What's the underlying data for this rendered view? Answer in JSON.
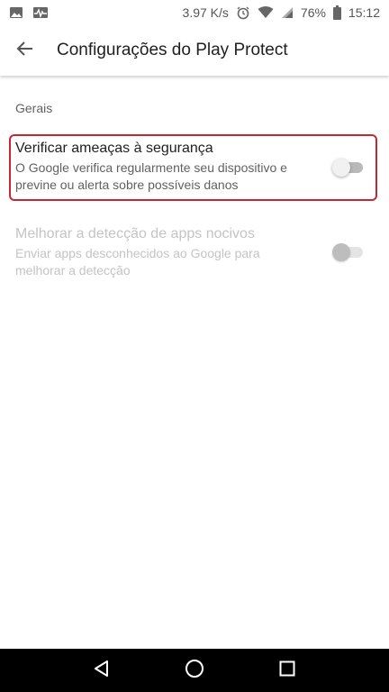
{
  "status_bar": {
    "left_icons": [
      "image-icon",
      "activity-icon"
    ],
    "speed": "3.97 K/s",
    "battery": "76%",
    "time": "15:12",
    "right_icons": [
      "alarm-icon",
      "wifi-icon",
      "signal-icon",
      "battery-icon"
    ]
  },
  "app_bar": {
    "back_icon": "arrow-back-icon",
    "title": "Configurações do Play Protect"
  },
  "section": {
    "header": "Gerais"
  },
  "settings": [
    {
      "title": "Verificar ameaças à segurança",
      "summary": "O Google verifica regularmente seu dispositivo e previne ou alerta sobre possíveis danos",
      "enabled": true,
      "checked": false
    },
    {
      "title": "Melhorar a detecção de apps nocivos",
      "summary": "Enviar apps desconhecidos ao Google para melhorar a detecção",
      "enabled": false,
      "checked": false
    }
  ],
  "highlight_color": "#c62833",
  "nav_bar": {
    "buttons": [
      "back-triangle-icon",
      "home-circle-icon",
      "recents-square-icon"
    ]
  }
}
